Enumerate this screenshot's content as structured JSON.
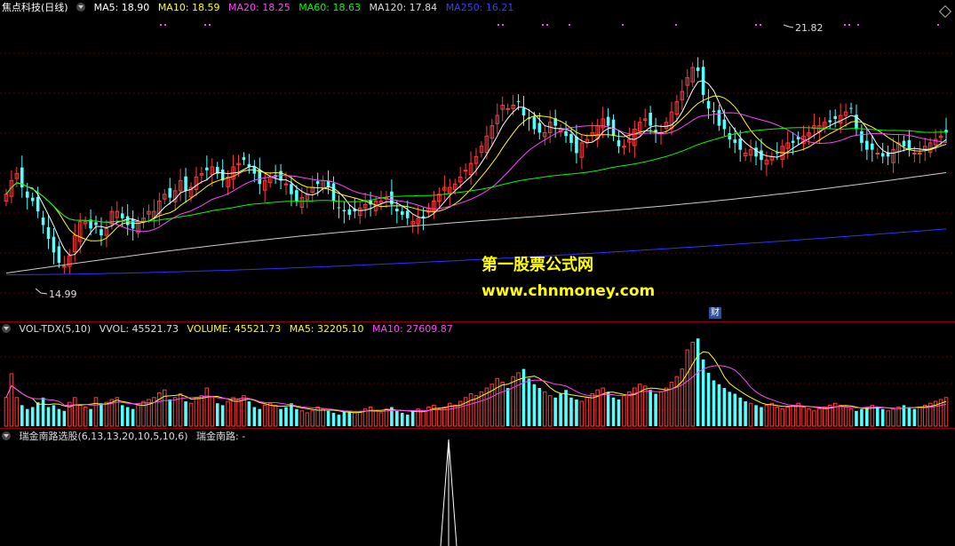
{
  "price_header": {
    "stock": "焦点科技(日线)",
    "ma5": "MA5: 18.90",
    "ma10": "MA10: 18.59",
    "ma20": "MA20: 18.25",
    "ma60": "MA60: 18.63",
    "ma120": "MA120: 17.84",
    "ma250": "MA250: 16.21"
  },
  "vol_header": {
    "name": "VOL-TDX(5,10)",
    "vvol": "VVOL: 45521.73",
    "volume": "VOLUME: 45521.73",
    "ma5": "MA5: 32205.10",
    "ma10": "MA10: 27609.87"
  },
  "ind_header": {
    "name": "瑞金南路选股(6,13,13,20,10,5,10,6)",
    "value": "瑞金南路: -"
  },
  "annotations": {
    "high": "21.82",
    "low": "14.99",
    "watermark_cn": "第一股票公式网",
    "watermark_url": "www.chnmoney.com",
    "finance_badge": "财"
  },
  "colors": {
    "up": "#ff3b3b",
    "down": "#54ffff",
    "ma5": "#ffffff",
    "ma10": "#ffff00",
    "ma20": "#ff44ff",
    "ma60": "#00ff00",
    "ma120": "#cccccc",
    "ma250": "#3030ff"
  },
  "chart_data": [
    {
      "type": "candlestick",
      "title": "焦点科技(日线)",
      "ylim": [
        14,
        22.5
      ],
      "x": [
        1,
        2,
        3,
        4,
        5,
        6,
        7,
        8,
        9,
        10,
        11,
        12,
        13,
        14,
        15,
        16,
        17,
        18,
        19,
        20,
        21,
        22,
        23,
        24,
        25,
        26,
        27,
        28,
        29,
        30,
        31,
        32,
        33,
        34,
        35,
        36,
        37,
        38,
        39,
        40,
        41,
        42,
        43,
        44,
        45,
        46,
        47,
        48,
        49,
        50,
        51,
        52,
        53,
        54,
        55,
        56,
        57,
        58,
        59,
        60,
        61,
        62,
        63,
        64,
        65,
        66,
        67,
        68,
        69,
        70,
        71,
        72,
        73,
        74,
        75,
        76,
        77,
        78,
        79,
        80,
        81,
        82,
        83,
        84,
        85,
        86,
        87,
        88,
        89,
        90,
        91,
        92,
        93,
        94,
        95,
        96,
        97,
        98,
        99,
        100,
        101,
        102,
        103,
        104,
        105,
        106,
        107,
        108,
        109,
        110,
        111,
        112,
        113,
        114,
        115,
        116,
        117,
        118,
        119,
        120,
        121,
        122,
        123,
        124,
        125,
        126,
        127,
        128,
        129,
        130,
        131,
        132,
        133,
        134,
        135,
        136,
        137,
        138,
        139,
        140,
        141,
        142,
        143,
        144,
        145,
        146,
        147,
        148,
        149,
        150,
        151,
        152,
        153,
        154,
        155,
        156,
        157,
        158,
        159,
        160,
        161,
        162,
        163,
        164,
        165,
        166,
        167,
        168,
        169,
        170,
        171,
        172,
        173,
        174,
        175,
        176,
        177,
        178,
        179
      ],
      "close": [
        17.4,
        17.8,
        18.0,
        17.6,
        17.3,
        17.2,
        16.9,
        16.5,
        16.1,
        15.7,
        15.4,
        15.3,
        15.6,
        16.2,
        16.6,
        16.6,
        16.4,
        16.5,
        16.2,
        16.4,
        16.9,
        16.9,
        16.7,
        16.5,
        16.4,
        16.6,
        16.7,
        16.9,
        16.9,
        17.2,
        17.4,
        17.3,
        17.5,
        17.8,
        17.5,
        17.6,
        17.9,
        18.0,
        18.1,
        18.2,
        18.0,
        17.8,
        17.9,
        18.2,
        18.3,
        18.4,
        18.2,
        18.0,
        17.7,
        17.8,
        17.9,
        17.9,
        17.8,
        17.7,
        17.4,
        17.2,
        17.3,
        17.4,
        17.6,
        17.7,
        17.8,
        17.6,
        17.2,
        17.0,
        16.9,
        16.8,
        16.9,
        17.0,
        17.1,
        17.1,
        17.2,
        17.2,
        17.3,
        17.1,
        16.9,
        16.8,
        16.7,
        16.6,
        16.7,
        16.7,
        17.0,
        17.2,
        17.4,
        17.6,
        17.6,
        17.7,
        17.9,
        18.1,
        18.3,
        18.5,
        18.8,
        19.1,
        19.4,
        19.7,
        20.0,
        19.9,
        20.0,
        20.1,
        19.7,
        19.6,
        19.3,
        19.2,
        19.2,
        19.5,
        19.4,
        19.3,
        19.1,
        18.9,
        18.6,
        18.9,
        19.0,
        19.2,
        19.4,
        19.6,
        19.4,
        19.1,
        18.8,
        18.8,
        19.0,
        19.3,
        19.5,
        19.6,
        19.4,
        19.2,
        19.2,
        19.5,
        19.8,
        20.1,
        20.4,
        20.8,
        21.1,
        21.0,
        20.3,
        19.9,
        19.8,
        19.4,
        19.3,
        19.0,
        18.9,
        18.7,
        18.6,
        18.7,
        18.5,
        18.4,
        18.4,
        18.5,
        18.6,
        18.8,
        18.9,
        18.9,
        19.0,
        19.1,
        19.2,
        19.4,
        19.4,
        19.5,
        19.5,
        19.6,
        19.7,
        19.8,
        19.9,
        19.3,
        18.9,
        18.7,
        18.7,
        18.6,
        18.5,
        18.5,
        18.7,
        18.9,
        18.8,
        18.7,
        18.6,
        18.6,
        18.8,
        18.9,
        19.0,
        19.1,
        19.2
      ],
      "max": 21.82,
      "min": 14.99
    },
    {
      "type": "bar",
      "title": "VOL-TDX(5,10)",
      "values": [
        30,
        55,
        30,
        22,
        18,
        20,
        25,
        30,
        20,
        22,
        18,
        16,
        25,
        30,
        22,
        20,
        18,
        30,
        24,
        25,
        28,
        30,
        22,
        20,
        18,
        22,
        26,
        28,
        30,
        35,
        38,
        28,
        30,
        34,
        26,
        24,
        30,
        32,
        40,
        30,
        24,
        22,
        26,
        30,
        28,
        32,
        26,
        20,
        18,
        22,
        24,
        22,
        18,
        20,
        24,
        18,
        16,
        14,
        16,
        20,
        18,
        16,
        14,
        12,
        15,
        16,
        14,
        15,
        18,
        20,
        16,
        14,
        18,
        20,
        16,
        14,
        12,
        16,
        18,
        16,
        20,
        22,
        18,
        20,
        24,
        22,
        26,
        30,
        34,
        32,
        36,
        40,
        44,
        50,
        46,
        40,
        52,
        56,
        60,
        50,
        44,
        40,
        36,
        32,
        30,
        34,
        38,
        30,
        28,
        26,
        30,
        34,
        38,
        40,
        36,
        30,
        28,
        32,
        36,
        40,
        44,
        42,
        38,
        34,
        36,
        40,
        46,
        52,
        60,
        80,
        88,
        92,
        70,
        56,
        48,
        44,
        40,
        36,
        34,
        30,
        26,
        24,
        22,
        20,
        22,
        24,
        20,
        18,
        20,
        22,
        24,
        20,
        18,
        16,
        18,
        20,
        22,
        24,
        22,
        20,
        18,
        16,
        18,
        20,
        22,
        20,
        18,
        16,
        18,
        20,
        22,
        20,
        18,
        20,
        22,
        24,
        26,
        28,
        30
      ]
    }
  ]
}
